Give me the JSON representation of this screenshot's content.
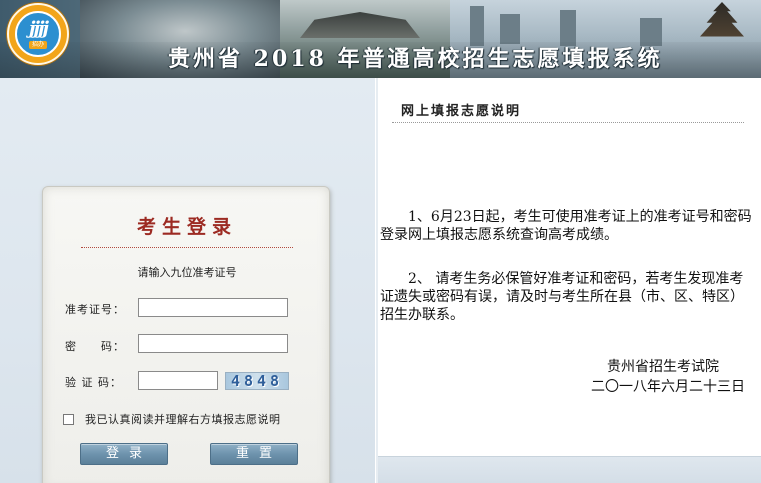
{
  "header": {
    "title": "贵州省 2018 年普通高校招生志愿填报系统",
    "logo": {
      "icon": "jjjj-logo-icon",
      "sub_text": "招办",
      "colors": {
        "ring": "#f2a51a",
        "center": "#2c8fd0"
      }
    }
  },
  "login": {
    "title": "考生登录",
    "hint": "请输入九位准考证号",
    "fields": {
      "exam_number": {
        "label": "准考证号：",
        "value": "",
        "placeholder": ""
      },
      "password": {
        "label": "密　　码：",
        "value": "",
        "placeholder": ""
      },
      "captcha": {
        "label": "验 证 码：",
        "value": "",
        "placeholder": "",
        "image_text": "4848"
      }
    },
    "agree_label": "我已认真阅读并理解右方填报志愿说明",
    "agree_checked": false,
    "login_button": "登录",
    "reset_button": "重置",
    "colors": {
      "title": "#9c2a22",
      "button": "#6e93ad"
    }
  },
  "notice": {
    "title": "网上填报志愿说明",
    "paragraphs": [
      "1、6月23日起，考生可使用准考证上的准考证号和密码登录网上填报志愿系统查询高考成绩。",
      "2、 请考生务必保管好准考证和密码，若考生发现准考证遗失或密码有误，请及时与考生所在县（市、区、特区）招生办联系。"
    ],
    "signature_org": "贵州省招生考试院",
    "signature_date": "二〇一八年六月二十三日"
  }
}
